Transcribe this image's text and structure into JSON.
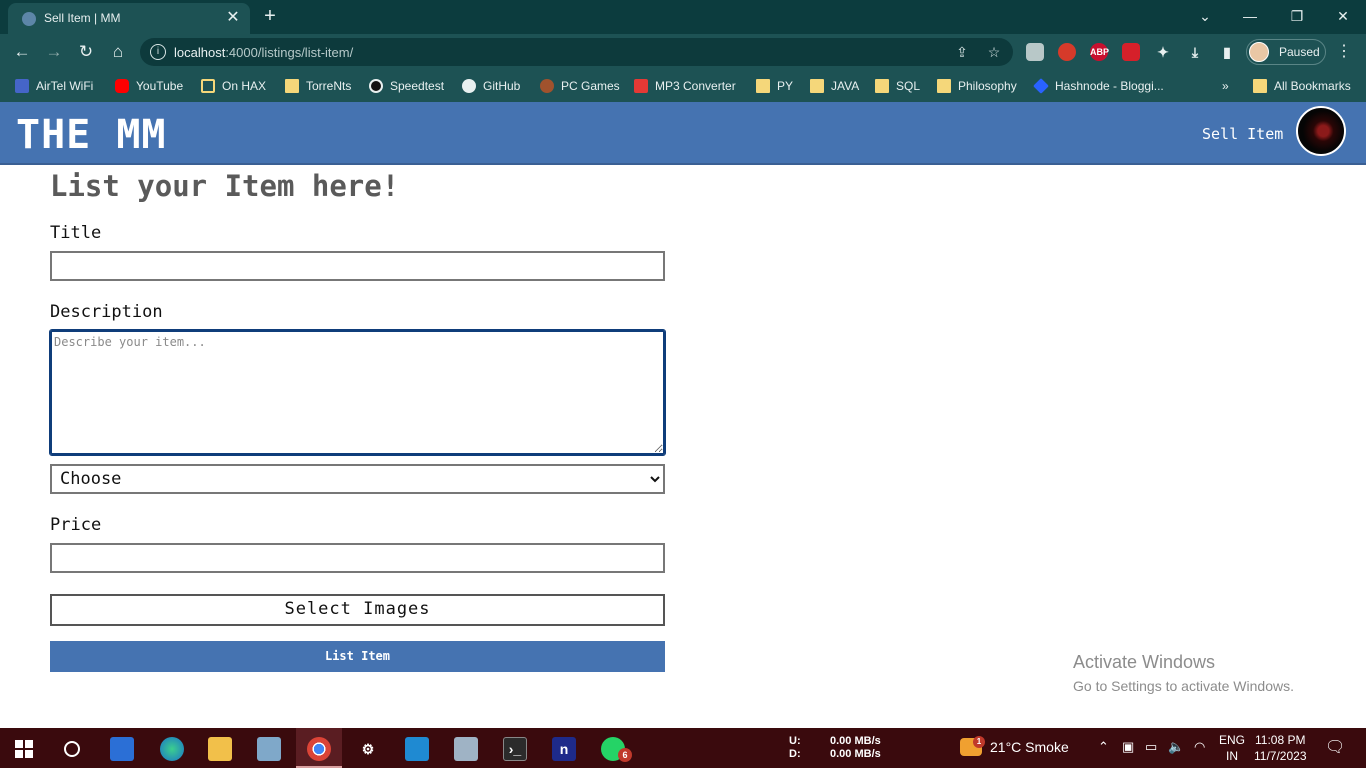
{
  "browser": {
    "tab_title": "Sell Item | MM",
    "url_host": "localhost",
    "url_rest": ":4000/listings/list-item/",
    "profile_label": "Paused",
    "extensions": {
      "abp_label": "ABP"
    },
    "bookmarks": [
      {
        "label": "AirTel WiFi"
      },
      {
        "label": "YouTube"
      },
      {
        "label": "On HAX"
      },
      {
        "label": "TorreNts"
      },
      {
        "label": "Speedtest"
      },
      {
        "label": "GitHub"
      },
      {
        "label": "PC Games"
      },
      {
        "label": "MP3 Converter"
      },
      {
        "label": "PY"
      },
      {
        "label": "JAVA"
      },
      {
        "label": "SQL"
      },
      {
        "label": "Philosophy"
      },
      {
        "label": "Hashnode - Bloggi..."
      },
      {
        "label": "All Bookmarks"
      }
    ],
    "overflow_label": "»"
  },
  "page": {
    "brand": "THE MM",
    "nav_sell_item": "Sell Item",
    "heading": "List your Item here!",
    "title_label": "Title",
    "title_value": "",
    "description_label": "Description",
    "description_placeholder": "Describe your item...",
    "category_selected": "Choose",
    "price_label": "Price",
    "price_value": "",
    "select_images_label": "Select Images",
    "submit_label": "List Item"
  },
  "watermark": {
    "title": "Activate Windows",
    "subtitle": "Go to Settings to activate Windows."
  },
  "taskbar": {
    "net_up_label": "U:",
    "net_down_label": "D:",
    "net_up_value": "0.00 MB/s",
    "net_down_value": "0.00 MB/s",
    "weather_badge": "1",
    "weather_text": "21°C  Smoke",
    "lang_top": "ENG",
    "lang_bottom": "IN",
    "time": "11:08 PM",
    "date": "11/7/2023",
    "whatsapp_badge": "6",
    "notepad_label": "n"
  },
  "colors": {
    "chrome_dark": "#0c3c3e",
    "chrome_toolbar": "#1d5254",
    "brand_blue": "#4573b1",
    "taskbar": "#3a0a0d"
  }
}
